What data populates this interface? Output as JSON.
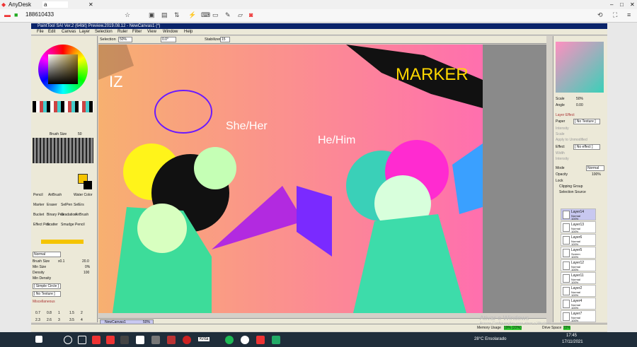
{
  "anydesk": {
    "app_name": "AnyDesk",
    "tab_label": "a",
    "session_id": "188610433"
  },
  "sai": {
    "title": "PaintTool SAI Ver.2 (64bit) Preview.2019.08.12 - NewCanvas1 (*)",
    "menu": [
      "File",
      "Edit",
      "Canvas",
      "Layer",
      "Selection",
      "Ruler",
      "Filter",
      "View",
      "Window",
      "Help"
    ],
    "toolbar": {
      "selection_label": "Selection",
      "zoom": "50%",
      "angle": "0.0°",
      "stabilizer_label": "Stabilizer",
      "stabilizer_value": "15"
    },
    "left": {
      "brush_size_label": "Brush Size",
      "brush_size_top": "50",
      "tools": [
        "Pencil",
        "AirBrush",
        "Water Color",
        "Marker",
        "Eraser",
        "SelPen",
        "SelErs",
        "Bucket",
        "Binary Pen",
        "Gradation",
        "AirBrush",
        "Effect Pen",
        "Scatter",
        "Smudge",
        "Pencil"
      ],
      "blend_mode": "Normal",
      "params": [
        {
          "label": "Brush Size",
          "mult": "x0.1",
          "value": "20.0"
        },
        {
          "label": "Min Size",
          "value": "0%"
        },
        {
          "label": "Density",
          "value": "100"
        },
        {
          "label": "Min Density",
          "value": ""
        }
      ],
      "shape": "[ Simple Circle ]",
      "texture": "[ No Texture ]",
      "misc": "Miscellaneous",
      "presets": [
        "0.7",
        "0.8",
        "1",
        "1.5",
        "2",
        "2.3",
        "2.6",
        "3",
        "3.5",
        "4"
      ]
    },
    "right": {
      "scale_label": "Scale",
      "scale_value": "50%",
      "angle_label": "Angle",
      "angle_value": "0.00",
      "layer_effect": "Layer Effect",
      "paper_label": "Paper",
      "paper_value": "[ No Texture ]",
      "intensity": "Intensity",
      "scale2": "Scale",
      "apply": "Apply to Unmodified",
      "effect_label": "Effect",
      "effect_value": "[ No effect ]",
      "width": "Width",
      "intensity2": "Intensity",
      "mode_label": "Mode",
      "mode_value": "Normal",
      "opacity_label": "Opacity",
      "opacity_value": "100%",
      "lock_label": "Lock",
      "clipping": "Clipping Group",
      "selection_source": "Selection Source",
      "layers": [
        {
          "name": "Layer14",
          "blend": "Normal",
          "opacity": "100%"
        },
        {
          "name": "Layer13",
          "blend": "Normal",
          "opacity": "100%"
        },
        {
          "name": "Layer6",
          "blend": "Normal",
          "opacity": "100%"
        },
        {
          "name": "Layer5",
          "blend": "Screen",
          "opacity": "100%"
        },
        {
          "name": "Layer12",
          "blend": "Normal",
          "opacity": "100%"
        },
        {
          "name": "Layer11",
          "blend": "Normal",
          "opacity": "100%"
        },
        {
          "name": "Layer2",
          "blend": "Normal",
          "opacity": "100%"
        },
        {
          "name": "Layer4",
          "blend": "Normal",
          "opacity": "100%"
        },
        {
          "name": "Layer7",
          "blend": "Normal",
          "opacity": "100%"
        }
      ]
    },
    "canvas_tab": {
      "name": "NewCanvas1",
      "zoom": "50%"
    },
    "status": {
      "memory_label": "Memory Usage",
      "memory_value": "19% (22%)",
      "drive_label": "Drive Space",
      "drive_value": "22%"
    },
    "canvas_text": {
      "she_her": "She/Her",
      "he_him": "He/Him",
      "marker": "MARKER",
      "iz": "IZ"
    }
  },
  "watermark": {
    "line1": "Ativar o Windows",
    "line2": "Acesse Configurações para ativar o Windows."
  },
  "taskbar": {
    "krita": "Krita",
    "weather": "28°C  Ensolarado",
    "time": "17:45",
    "date": "17/11/2021"
  },
  "colors": {
    "titlebar": "#0a246a",
    "canvas_left": "#f4a96a",
    "canvas_right": "#ff6fae",
    "taskbar": "#1f2d3a"
  }
}
